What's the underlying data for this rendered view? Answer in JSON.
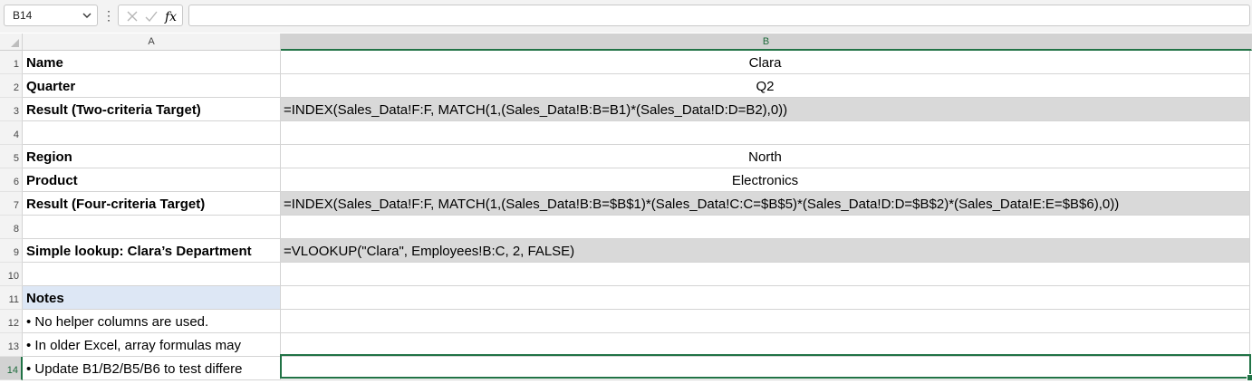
{
  "formula_bar": {
    "name_box": "B14",
    "formula": ""
  },
  "columns": [
    "A",
    "B"
  ],
  "selected_column": "B",
  "selected_cell": "B14",
  "rows": [
    {
      "num": "1",
      "a": "Name",
      "b": "Clara"
    },
    {
      "num": "2",
      "a": "Quarter",
      "b": "Q2"
    },
    {
      "num": "3",
      "a": "Result (Two-criteria Target)",
      "b": "=INDEX(Sales_Data!F:F, MATCH(1,(Sales_Data!B:B=B1)*(Sales_Data!D:D=B2),0))"
    },
    {
      "num": "4",
      "a": "",
      "b": ""
    },
    {
      "num": "5",
      "a": "Region",
      "b": "North"
    },
    {
      "num": "6",
      "a": "Product",
      "b": "Electronics"
    },
    {
      "num": "7",
      "a": "Result (Four-criteria Target)",
      "b": "=INDEX(Sales_Data!F:F, MATCH(1,(Sales_Data!B:B=$B$1)*(Sales_Data!C:C=$B$5)*(Sales_Data!D:D=$B$2)*(Sales_Data!E:E=$B$6),0))"
    },
    {
      "num": "8",
      "a": "",
      "b": ""
    },
    {
      "num": "9",
      "a": "Simple lookup: Clara’s Department",
      "b": "=VLOOKUP(\"Clara\", Employees!B:C, 2, FALSE)"
    },
    {
      "num": "10",
      "a": "",
      "b": ""
    },
    {
      "num": "11",
      "a": "Notes",
      "b": ""
    },
    {
      "num": "12",
      "a": "• No helper columns are used.",
      "b": ""
    },
    {
      "num": "13",
      "a": "• In older Excel, array formulas may",
      "b": ""
    },
    {
      "num": "14",
      "a": "• Update B1/B2/B5/B6 to test differe",
      "b": ""
    }
  ],
  "colors": {
    "accent": "#217346",
    "formula_fill": "#d9d9d9",
    "notes_fill": "#dde7f5",
    "header_bg": "#f3f3f3"
  }
}
